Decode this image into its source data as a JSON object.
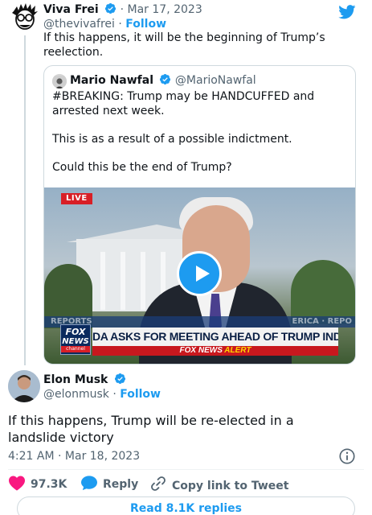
{
  "parent_tweet": {
    "author_name": "Viva Frei",
    "dot": "·",
    "date": "Mar 17, 2023",
    "handle": "@thevivafrei",
    "follow_label": "Follow",
    "text": "If this happens, it will be the beginning of Trump’s reelection.",
    "avatar_icon": "cartoon-portrait-icon",
    "brand_icon": "twitter-bird-icon"
  },
  "quoted_tweet": {
    "author_name": "Mario Nawfal",
    "handle": "@MarioNawfal",
    "paragraphs": [
      "#BREAKING: Trump may be HANDCUFFED and arrested next week.",
      "This is as a result of a possible indictment.",
      "Could this be the end of Trump?"
    ],
    "video": {
      "live_label": "LIVE",
      "ticker_left": "REPORTS",
      "ticker_right": "ERICA · REPO",
      "network_logo_line1": "FOX",
      "network_logo_line2": "NEWS",
      "network_logo_line3": "channel",
      "headline": "DA ASKS FOR MEETING AHEAD OF TRUMP INDICTMENT",
      "alert_prefix": "FOX NEWS",
      "alert_word": "ALERT",
      "play_icon": "play-icon"
    }
  },
  "main_tweet": {
    "author_name": "Elon Musk",
    "handle": "@elonmusk",
    "dot": "·",
    "follow_label": "Follow",
    "text": "If this happens, Trump will be re-elected in a landslide victory",
    "time": "4:21 AM",
    "date": "Mar 18, 2023",
    "info_icon": "info-icon"
  },
  "actions": {
    "like_count": "97.3K",
    "reply_label": "Reply",
    "copy_label": "Copy link to Tweet"
  },
  "read_replies_label": "Read 8.1K replies",
  "colors": {
    "accent": "#1d9bf0",
    "like": "#f91880",
    "muted": "#536471",
    "text": "#0f1419",
    "border": "#cfd9de"
  }
}
